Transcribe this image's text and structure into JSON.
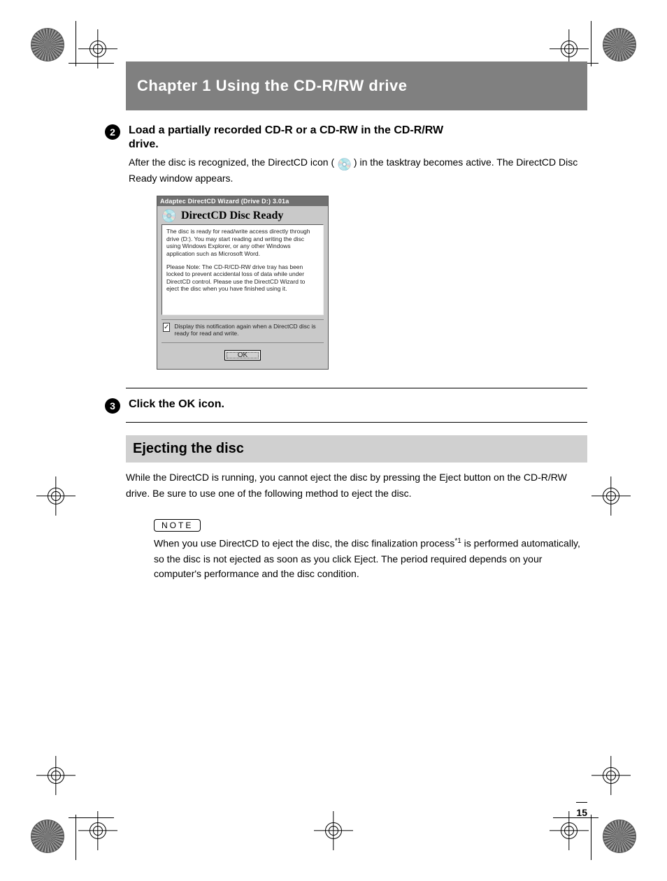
{
  "chapter": "Chapter 1  Using the CD-R/RW drive",
  "step2": {
    "num": "2",
    "title_line1": "Load a partially recorded CD-R or a CD-RW in the CD-R/RW",
    "title_line2": "drive.",
    "desc_before_icon": "After the disc is recognized, the DirectCD icon (",
    "desc_after_icon": ") in the tasktray becomes active. The DirectCD Disc Ready window appears."
  },
  "dialog": {
    "titlebar": "Adaptec DirectCD Wizard (Drive D:) 3.01a",
    "ready_title": "DirectCD Disc Ready",
    "msg1": "The disc is ready for read/write access directly through drive (D:). You may start reading and writing the disc using Windows Explorer, or any other Windows application such as Microsoft Word.",
    "msg2": "Please Note: The CD-R/CD-RW drive tray has been locked to prevent accidental loss of data while under DirectCD control. Please use the DirectCD Wizard to eject the disc when you have finished using it.",
    "check_label": "Display this notification again when a DirectCD disc is ready for read and write.",
    "ok_label": "OK"
  },
  "step3": {
    "num": "3",
    "title": "Click the OK icon."
  },
  "section": {
    "heading": "Ejecting the disc",
    "para": "While the DirectCD is running, you cannot eject the disc by pressing the Eject button on the CD-R/RW drive. Be sure to use one of the following method to eject the disc."
  },
  "note": {
    "label": "NOTE",
    "body_before_sup": "When you use DirectCD to eject the disc, the disc finalization process",
    "sup": "*1",
    "body_after_sup": " is performed automatically, so the disc is not ejected as soon as you click Eject. The period required depends on your computer's performance and the disc condition."
  },
  "page_number": "15"
}
